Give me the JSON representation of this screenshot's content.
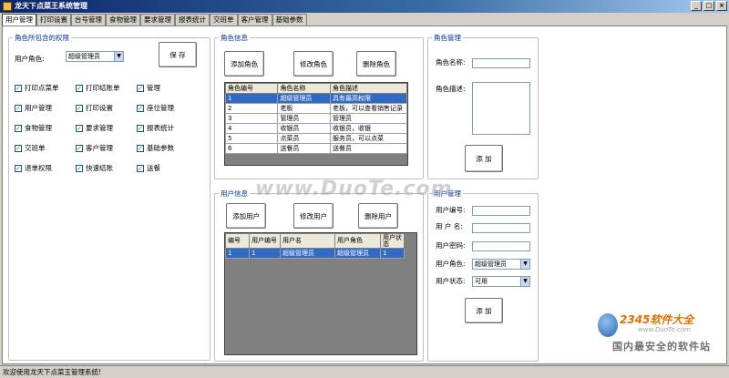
{
  "window": {
    "title": "龙天下点菜王系统管理",
    "btn_min": "_",
    "btn_max": "□",
    "btn_close": "×"
  },
  "tabs": [
    "用户管理",
    "打印设置",
    "台号管理",
    "食物管理",
    "要求管理",
    "报表统计",
    "交班单",
    "客户管理",
    "基础参数"
  ],
  "permissions": {
    "title": "角色所包含的权限",
    "role_label": "用户角色:",
    "role_value": "超级管理员",
    "save_label": "保 存",
    "items": [
      "打印点菜单",
      "打印结账单",
      "管理",
      "用户管理",
      "打印设置",
      "座位管理",
      "食物管理",
      "要求管理",
      "报表统计",
      "交班单",
      "客户管理",
      "基础参数",
      "退单权限",
      "快速结账",
      "送餐"
    ]
  },
  "role_info": {
    "title": "角色信息",
    "add": "添加角色",
    "edit": "修改角色",
    "delete": "删除角色",
    "columns": [
      "角色编号",
      "角色名称",
      "角色描述"
    ],
    "rows": [
      [
        "1",
        "超级管理员",
        "具有最高权限"
      ],
      [
        "2",
        "老板",
        "老板，可以查看销售记录"
      ],
      [
        "3",
        "管理员",
        "管理员"
      ],
      [
        "4",
        "收银员",
        "收银员，收银"
      ],
      [
        "5",
        "点菜员",
        "服务员，可以点菜"
      ],
      [
        "6",
        "送餐员",
        "送餐员"
      ]
    ]
  },
  "role_mgmt": {
    "title": "角色管理",
    "name_label": "角色名称:",
    "desc_label": "角色描述:",
    "add": "添 加"
  },
  "user_info": {
    "title": "用户信息",
    "add": "添加用户",
    "edit": "修改用户",
    "delete": "删除用户",
    "columns": [
      "编号",
      "用户编号",
      "用户名",
      "用户角色",
      "用户状态"
    ],
    "rows": [
      [
        "1",
        "1",
        "超级管理员",
        "超级管理员",
        "1"
      ]
    ]
  },
  "user_mgmt": {
    "title": "用户管理",
    "id_label": "用户编号:",
    "name_label": "用 户 名:",
    "pwd_label": "用户密码:",
    "role_label": "用户角色:",
    "role_value": "超级管理员",
    "state_label": "用户状态:",
    "state_value": "可用",
    "add": "添 加"
  },
  "watermark": "www.DuoTe.com",
  "logo": {
    "line1": "2345软件大全",
    "line2": "www.DuoTe.com",
    "line3": "国内最安全的软件站"
  },
  "status": "欢迎使用龙天下点菜王管理系统!"
}
